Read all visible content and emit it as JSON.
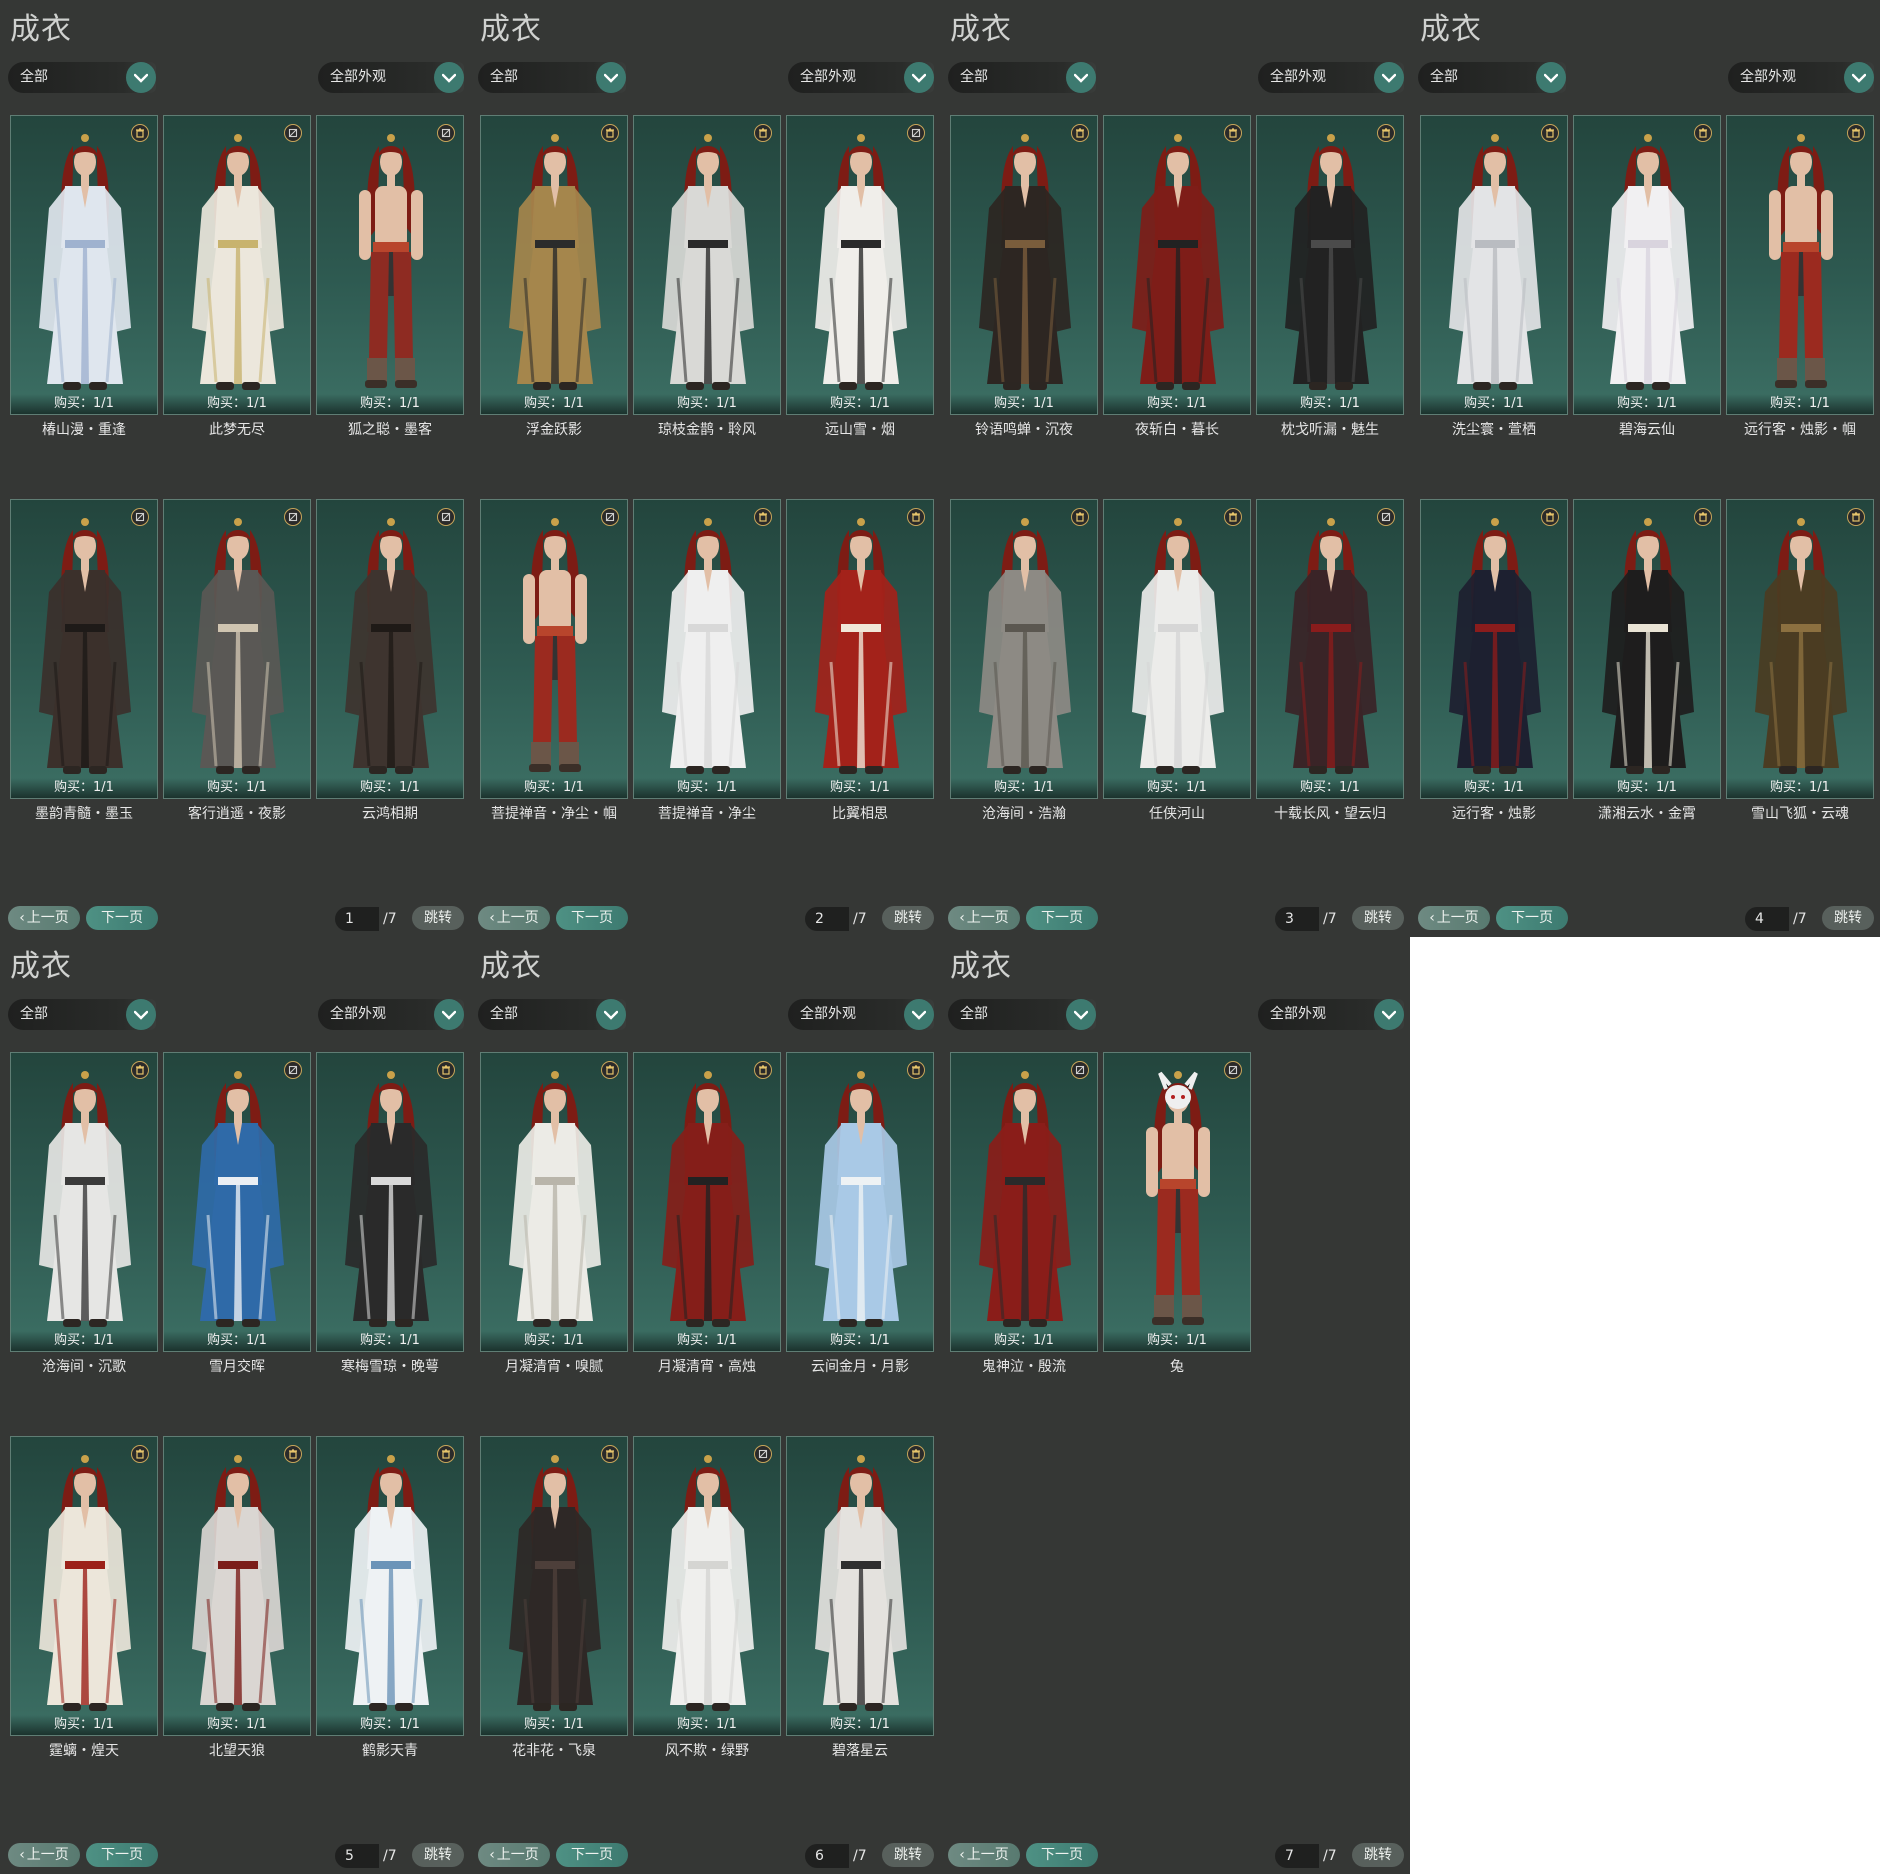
{
  "colors": {
    "panel_bg": "#353735",
    "card_top": "#23453d",
    "card_bottom": "#3c6f64",
    "accent_teal": "#3d7a70",
    "hair_red": "#7d1c14"
  },
  "panels": [
    {
      "title": "成衣",
      "category_select": "全部",
      "appearance_select": "全部外观",
      "items": [
        {
          "name": "椿山漫・重逢",
          "purchase": "购买：1/1",
          "outfit": "#dfe6ee",
          "trim": "#9fb2cf",
          "icon": "trash-icon"
        },
        {
          "name": "此梦无尽",
          "purchase": "购买：1/1",
          "outfit": "#ece7dc",
          "trim": "#c8b36e",
          "icon": "no-dye-icon"
        },
        {
          "name": "狐之聪・墨客",
          "purchase": "购买：1/1",
          "outfit": "#8e2b22",
          "trim": "#333333",
          "icon": "no-dye-icon",
          "bare": true
        },
        {
          "name": "墨韵青髓・墨玉",
          "purchase": "购买：1/1",
          "outfit": "#3b302b",
          "trim": "#1e1a18",
          "icon": "no-dye-icon"
        },
        {
          "name": "客行逍遥・夜影",
          "purchase": "购买：1/1",
          "outfit": "#5a5855",
          "trim": "#cfc4b0",
          "icon": "no-dye-icon"
        },
        {
          "name": "云鸿相期",
          "purchase": "购买：1/1",
          "outfit": "#3e342f",
          "trim": "#1f1a17",
          "icon": "no-dye-icon"
        }
      ],
      "page_current": "1",
      "page_total": "/7"
    },
    {
      "title": "成衣",
      "category_select": "全部",
      "appearance_select": "全部外观",
      "items": [
        {
          "name": "浮金跃影",
          "purchase": "购买：1/1",
          "outfit": "#a5864c",
          "trim": "#2b2b2b",
          "icon": "trash-icon"
        },
        {
          "name": "琼枝金鹊・聆风",
          "purchase": "购买：1/1",
          "outfit": "#d9d9d6",
          "trim": "#2a2a2a",
          "icon": "trash-icon"
        },
        {
          "name": "远山雪・烟",
          "purchase": "购买：1/1",
          "outfit": "#f0eeea",
          "trim": "#2a2a2a",
          "icon": "no-dye-icon"
        },
        {
          "name": "菩提禅音・净尘・帼",
          "purchase": "购买：1/1",
          "outfit": "#9b2a1f",
          "trim": "#333333",
          "icon": "no-dye-icon",
          "bare": true
        },
        {
          "name": "菩提禅音・净尘",
          "purchase": "购买：1/1",
          "outfit": "#efefef",
          "trim": "#d8d8d8",
          "icon": "trash-icon"
        },
        {
          "name": "比翼相思",
          "purchase": "购买：1/1",
          "outfit": "#a3221a",
          "trim": "#f0e7d8",
          "icon": "trash-icon"
        }
      ],
      "page_current": "2",
      "page_total": "/7"
    },
    {
      "title": "成衣",
      "category_select": "全部",
      "appearance_select": "全部外观",
      "items": [
        {
          "name": "铃语鸣蝉・沉夜",
          "purchase": "购买：1/1",
          "outfit": "#2d2622",
          "trim": "#7a5d3c",
          "icon": "trash-icon"
        },
        {
          "name": "夜斩白・暮长",
          "purchase": "购买：1/1",
          "outfit": "#7e1d18",
          "trim": "#222222",
          "icon": "trash-icon"
        },
        {
          "name": "枕戈听漏・魅生",
          "purchase": "购买：1/1",
          "outfit": "#222222",
          "trim": "#4b4b4b",
          "icon": "trash-icon"
        },
        {
          "name": "沧海间・浩瀚",
          "purchase": "购买：1/1",
          "outfit": "#8d8a84",
          "trim": "#5b5750",
          "icon": "trash-icon"
        },
        {
          "name": "任侠河山",
          "purchase": "购买：1/1",
          "outfit": "#ececea",
          "trim": "#d6d6d6",
          "icon": "trash-icon"
        },
        {
          "name": "十载长风・望云归",
          "purchase": "购买：1/1",
          "outfit": "#3a2427",
          "trim": "#8a1c1c",
          "icon": "no-dye-icon"
        }
      ],
      "page_current": "3",
      "page_total": "/7"
    },
    {
      "title": "成衣",
      "category_select": "全部",
      "appearance_select": "全部外观",
      "items": [
        {
          "name": "洗尘寰・萱栖",
          "purchase": "购买：1/1",
          "outfit": "#e3e4e6",
          "trim": "#b9bcc1",
          "icon": "trash-icon"
        },
        {
          "name": "碧海云仙",
          "purchase": "购买：1/1",
          "outfit": "#f1f0f2",
          "trim": "#d9d4de",
          "icon": "trash-icon"
        },
        {
          "name": "远行客・烛影・帼",
          "purchase": "购买：1/1",
          "outfit": "#9b2a1f",
          "trim": "#333333",
          "icon": "trash-icon",
          "bare": true
        },
        {
          "name": "远行客・烛影",
          "purchase": "购买：1/1",
          "outfit": "#1d2030",
          "trim": "#8a1c1c",
          "icon": "trash-icon"
        },
        {
          "name": "潇湘云水・金霄",
          "purchase": "购买：1/1",
          "outfit": "#1e1d1d",
          "trim": "#e9e3d4",
          "icon": "trash-icon"
        },
        {
          "name": "雪山飞狐・云魂",
          "purchase": "购买：1/1",
          "outfit": "#4b3c22",
          "trim": "#8c7040",
          "icon": "trash-icon"
        }
      ],
      "page_current": "4",
      "page_total": "/7"
    },
    {
      "title": "成衣",
      "category_select": "全部",
      "appearance_select": "全部外观",
      "items": [
        {
          "name": "沧海间・沉歌",
          "purchase": "购买：1/1",
          "outfit": "#e6e6e4",
          "trim": "#3a3a3a",
          "icon": "trash-icon"
        },
        {
          "name": "雪月交晖",
          "purchase": "购买：1/1",
          "outfit": "#2f6aa8",
          "trim": "#eaeef3",
          "icon": "no-dye-icon"
        },
        {
          "name": "寒梅雪琼・晚萼",
          "purchase": "购买：1/1",
          "outfit": "#2a2a2a",
          "trim": "#d9d9d9",
          "icon": "trash-icon"
        },
        {
          "name": "霆螭・煌天",
          "purchase": "购买：1/1",
          "outfit": "#ece6da",
          "trim": "#9c2119",
          "icon": "trash-icon"
        },
        {
          "name": "北望天狼",
          "purchase": "购买：1/1",
          "outfit": "#dad6d2",
          "trim": "#7b1d19",
          "icon": "trash-icon"
        },
        {
          "name": "鹤影天青",
          "purchase": "购买：1/1",
          "outfit": "#eef2f4",
          "trim": "#6b94b8",
          "icon": "trash-icon"
        }
      ],
      "page_current": "5",
      "page_total": "/7"
    },
    {
      "title": "成衣",
      "category_select": "全部",
      "appearance_select": "全部外观",
      "items": [
        {
          "name": "月凝清宵・嗅腻",
          "purchase": "购买：1/1",
          "outfit": "#ecebe6",
          "trim": "#b9b5aa",
          "icon": "trash-icon"
        },
        {
          "name": "月凝清宵・高烛",
          "purchase": "购买：1/1",
          "outfit": "#851e19",
          "trim": "#222222",
          "icon": "trash-icon"
        },
        {
          "name": "云间金月・月影",
          "purchase": "购买：1/1",
          "outfit": "#a9c9e6",
          "trim": "#eef2f4",
          "icon": "trash-icon"
        },
        {
          "name": "花非花・飞泉",
          "purchase": "购买：1/1",
          "outfit": "#2e2826",
          "trim": "#4d3f3a",
          "icon": "trash-icon"
        },
        {
          "name": "风不欺・绿野",
          "purchase": "购买：1/1",
          "outfit": "#efefed",
          "trim": "#d5d5d2",
          "icon": "no-dye-icon"
        },
        {
          "name": "碧落星云",
          "purchase": "购买：1/1",
          "outfit": "#e4e2de",
          "trim": "#2f2f2f",
          "icon": "trash-icon"
        }
      ],
      "page_current": "6",
      "page_total": "/7"
    },
    {
      "title": "成衣",
      "category_select": "全部",
      "appearance_select": "全部外观",
      "items": [
        {
          "name": "鬼神泣・殷流",
          "purchase": "购买：1/1",
          "outfit": "#8a1d19",
          "trim": "#2a2a2a",
          "icon": "no-dye-icon"
        },
        {
          "name": "兔",
          "purchase": "购买：1/1",
          "outfit": "#9b2a1f",
          "trim": "#333333",
          "icon": "no-dye-icon",
          "bare": true,
          "mask": true
        }
      ],
      "page_current": "7",
      "page_total": "/7"
    }
  ],
  "pagination": {
    "prev_label": "上一页",
    "next_label": "下一页",
    "jump_label": "跳转"
  }
}
